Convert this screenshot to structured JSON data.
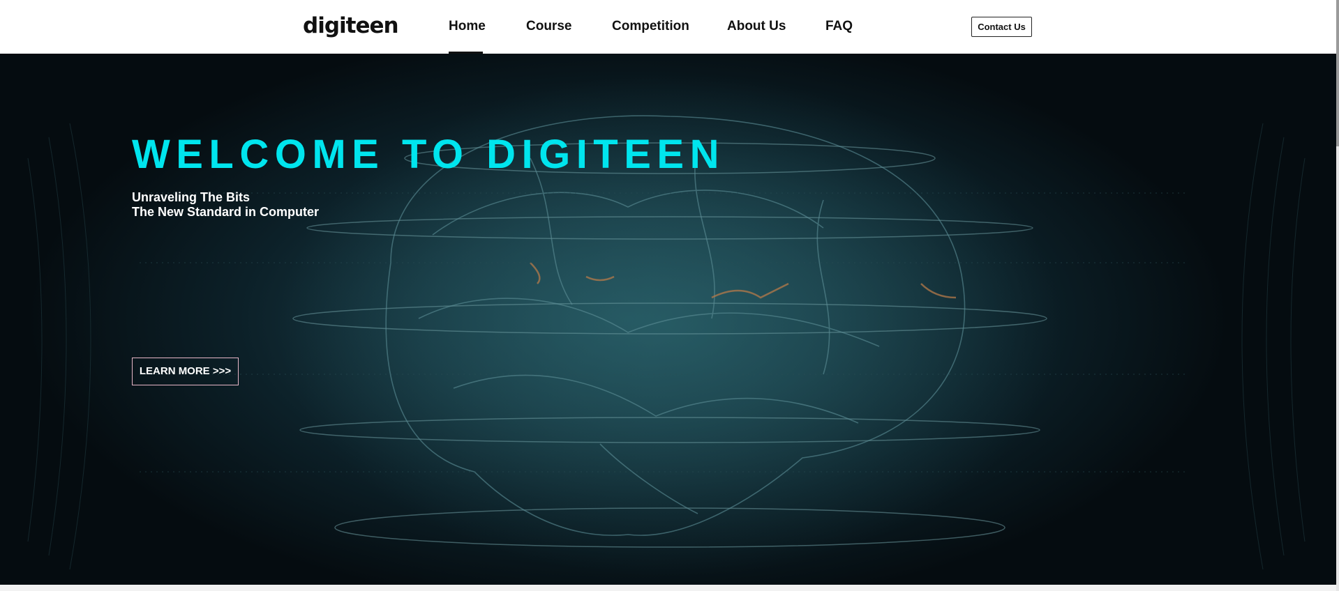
{
  "header": {
    "logo_text": "digiteen",
    "nav": [
      {
        "label": "Home",
        "active": true
      },
      {
        "label": "Course"
      },
      {
        "label": "Competition"
      },
      {
        "label": "About Us"
      },
      {
        "label": "FAQ"
      }
    ],
    "contact_label": "Contact Us"
  },
  "hero": {
    "title": "WELCOME TO DIGITEEN",
    "subtitle_line1": "Unraveling The Bits",
    "subtitle_line2": "The New Standard in Computer",
    "cta_label": "LEARN MORE >>>",
    "background": "brain-hologram-image"
  },
  "colors": {
    "accent": "#00e5ee",
    "hero_dark": "#050c10",
    "hero_glow": "#1f4a55",
    "button_border": "#e8b7c8"
  }
}
